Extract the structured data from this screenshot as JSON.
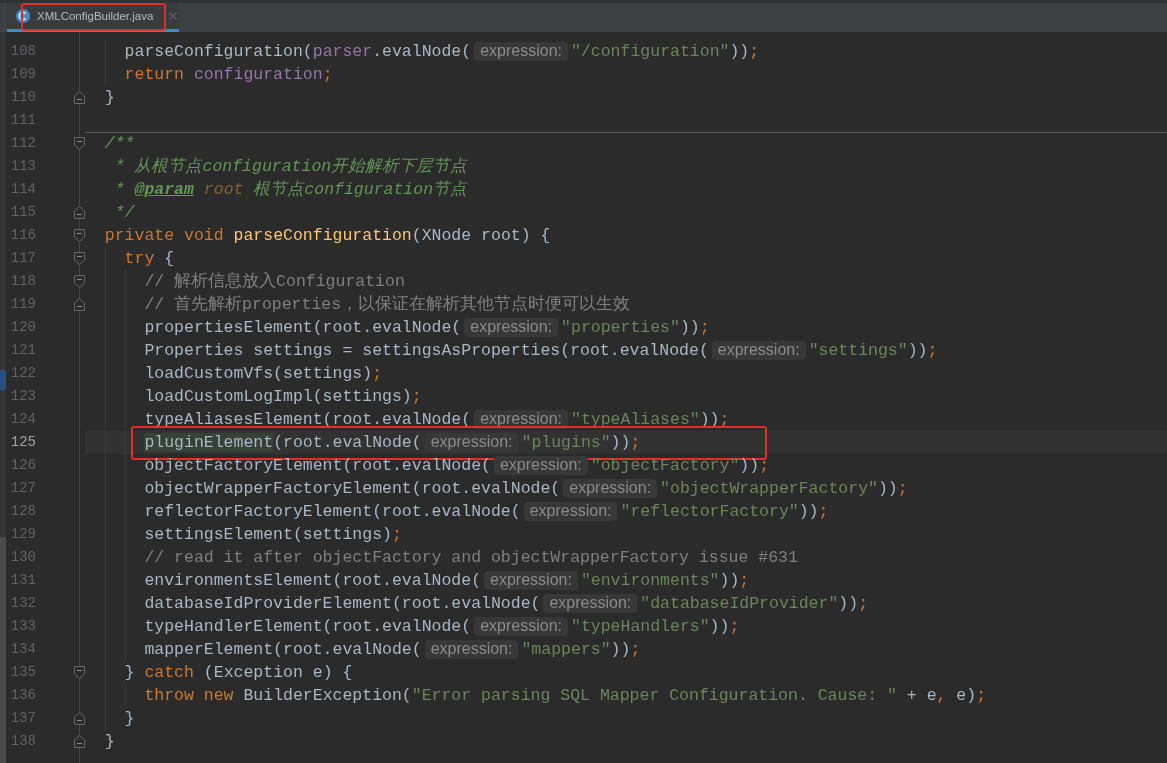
{
  "tabs": [
    {
      "label": "XMLConfigBuilder.java",
      "selected": true,
      "boxed": true
    }
  ],
  "editor": {
    "lines": [
      {
        "number": "108",
        "current": false,
        "boxed": false,
        "separator": false,
        "fold_start": false,
        "fold_end": false,
        "parts": [
          {
            "kind": "code",
            "tokens": [
              {
                "kind": "plain",
                "text": "    parseConfiguration("
              },
              {
                "kind": "field",
                "text": "parser"
              },
              {
                "kind": "plain",
                "text": ".evalNode("
              }
            ]
          },
          {
            "kind": "hint",
            "text": "expression:"
          },
          {
            "kind": "code",
            "tokens": [
              {
                "kind": "string",
                "text": "\"/configuration\""
              },
              {
                "kind": "plain",
                "text": "))"
              },
              {
                "kind": "separator",
                "text": ";"
              }
            ]
          }
        ]
      },
      {
        "number": "109",
        "current": false,
        "boxed": false,
        "separator": false,
        "fold_start": false,
        "fold_end": false,
        "parts": [
          {
            "kind": "code",
            "tokens": [
              {
                "kind": "keyword",
                "text": "    return "
              },
              {
                "kind": "field",
                "text": "configuration"
              },
              {
                "kind": "separator",
                "text": ";"
              }
            ]
          }
        ]
      },
      {
        "number": "110",
        "current": false,
        "boxed": false,
        "separator": false,
        "fold_start": false,
        "fold_end": true,
        "parts": [
          {
            "kind": "code",
            "tokens": [
              {
                "kind": "plain",
                "text": "  }"
              }
            ]
          }
        ]
      },
      {
        "number": "111",
        "current": false,
        "boxed": false,
        "separator": false,
        "fold_start": false,
        "fold_end": false
      },
      {
        "number": "112",
        "current": false,
        "boxed": false,
        "separator": true,
        "fold_start": true,
        "fold_end": false,
        "parts": [
          {
            "kind": "code",
            "tokens": [
              {
                "kind": "doc",
                "text": "  /**"
              }
            ]
          }
        ]
      },
      {
        "number": "113",
        "current": false,
        "boxed": false,
        "separator": false,
        "fold_start": false,
        "fold_end": false,
        "parts": [
          {
            "kind": "code",
            "tokens": [
              {
                "kind": "doc",
                "text": "   * 从根节点configuration开始解析下层节点"
              }
            ]
          }
        ]
      },
      {
        "number": "114",
        "current": false,
        "boxed": false,
        "separator": false,
        "fold_start": false,
        "fold_end": false,
        "parts": [
          {
            "kind": "code",
            "tokens": [
              {
                "kind": "doc",
                "text": "   * "
              },
              {
                "kind": "doc-tag",
                "text": "@param"
              },
              {
                "kind": "doc-value",
                "text": " root"
              },
              {
                "kind": "doc",
                "text": " 根节点configuration节点"
              }
            ]
          }
        ]
      },
      {
        "number": "115",
        "current": false,
        "boxed": false,
        "separator": false,
        "fold_start": false,
        "fold_end": true,
        "parts": [
          {
            "kind": "code",
            "tokens": [
              {
                "kind": "doc",
                "text": "   */"
              }
            ]
          }
        ]
      },
      {
        "number": "116",
        "current": false,
        "boxed": false,
        "separator": false,
        "fold_start": true,
        "fold_end": false,
        "parts": [
          {
            "kind": "code",
            "tokens": [
              {
                "kind": "keyword",
                "text": "  private void "
              },
              {
                "kind": "method",
                "text": "parseConfiguration"
              },
              {
                "kind": "plain",
                "text": "(XNode root) {"
              }
            ]
          }
        ]
      },
      {
        "number": "117",
        "current": false,
        "boxed": false,
        "separator": false,
        "fold_start": true,
        "fold_end": false,
        "parts": [
          {
            "kind": "code",
            "tokens": [
              {
                "kind": "keyword",
                "text": "    try"
              },
              {
                "kind": "plain",
                "text": " {"
              }
            ]
          }
        ]
      },
      {
        "number": "118",
        "current": false,
        "boxed": false,
        "separator": false,
        "fold_start": true,
        "fold_end": false,
        "parts": [
          {
            "kind": "code",
            "tokens": [
              {
                "kind": "comment",
                "text": "      // 解析信息放入Configuration"
              }
            ]
          }
        ]
      },
      {
        "number": "119",
        "current": false,
        "boxed": false,
        "separator": false,
        "fold_start": false,
        "fold_end": true,
        "parts": [
          {
            "kind": "code",
            "tokens": [
              {
                "kind": "comment",
                "text": "      // 首先解析properties，以保证在解析其他节点时便可以生效"
              }
            ]
          }
        ]
      },
      {
        "number": "120",
        "current": false,
        "boxed": false,
        "separator": false,
        "fold_start": false,
        "fold_end": false,
        "parts": [
          {
            "kind": "code",
            "tokens": [
              {
                "kind": "plain",
                "text": "      propertiesElement(root.evalNode("
              }
            ]
          },
          {
            "kind": "hint",
            "text": "expression:"
          },
          {
            "kind": "code",
            "tokens": [
              {
                "kind": "string",
                "text": "\"properties\""
              },
              {
                "kind": "plain",
                "text": "))"
              },
              {
                "kind": "separator",
                "text": ";"
              }
            ]
          }
        ]
      },
      {
        "number": "121",
        "current": false,
        "boxed": false,
        "separator": false,
        "fold_start": false,
        "fold_end": false,
        "parts": [
          {
            "kind": "code",
            "tokens": [
              {
                "kind": "plain",
                "text": "      Properties settings = settingsAsProperties(root.evalNode("
              }
            ]
          },
          {
            "kind": "hint",
            "text": "expression:"
          },
          {
            "kind": "code",
            "tokens": [
              {
                "kind": "string",
                "text": "\"settings\""
              },
              {
                "kind": "plain",
                "text": "))"
              },
              {
                "kind": "separator",
                "text": ";"
              }
            ]
          }
        ]
      },
      {
        "number": "122",
        "current": false,
        "boxed": false,
        "separator": false,
        "fold_start": false,
        "fold_end": false,
        "parts": [
          {
            "kind": "code",
            "tokens": [
              {
                "kind": "plain",
                "text": "      loadCustomVfs(settings)"
              },
              {
                "kind": "separator",
                "text": ";"
              }
            ]
          }
        ]
      },
      {
        "number": "123",
        "current": false,
        "boxed": false,
        "separator": false,
        "fold_start": false,
        "fold_end": false,
        "parts": [
          {
            "kind": "code",
            "tokens": [
              {
                "kind": "plain",
                "text": "      loadCustomLogImpl(settings)"
              },
              {
                "kind": "separator",
                "text": ";"
              }
            ]
          }
        ]
      },
      {
        "number": "124",
        "current": false,
        "boxed": false,
        "separator": false,
        "fold_start": false,
        "fold_end": false,
        "parts": [
          {
            "kind": "code",
            "tokens": [
              {
                "kind": "plain",
                "text": "      typeAliasesElement(root.evalNode("
              }
            ]
          },
          {
            "kind": "hint",
            "text": "expression:"
          },
          {
            "kind": "code",
            "tokens": [
              {
                "kind": "string",
                "text": "\"typeAliases\""
              },
              {
                "kind": "plain",
                "text": "))"
              },
              {
                "kind": "separator",
                "text": ";"
              }
            ]
          }
        ]
      },
      {
        "number": "125",
        "current": true,
        "boxed": true,
        "separator": false,
        "fold_start": false,
        "fold_end": false,
        "parts": [
          {
            "kind": "code",
            "tokens": [
              {
                "kind": "usage",
                "text": "      pluginElement"
              },
              {
                "kind": "plain",
                "text": "(root.evalNode("
              }
            ]
          },
          {
            "kind": "hint",
            "text": "expression:"
          },
          {
            "kind": "code",
            "tokens": [
              {
                "kind": "string",
                "text": "\"plugins\""
              },
              {
                "kind": "plain",
                "text": "))"
              },
              {
                "kind": "separator",
                "text": ";"
              }
            ]
          }
        ]
      },
      {
        "number": "126",
        "current": false,
        "boxed": false,
        "separator": false,
        "fold_start": false,
        "fold_end": false,
        "parts": [
          {
            "kind": "code",
            "tokens": [
              {
                "kind": "plain",
                "text": "      objectFactoryElement(root.evalNode("
              }
            ]
          },
          {
            "kind": "hint",
            "text": "expression:"
          },
          {
            "kind": "code",
            "tokens": [
              {
                "kind": "string",
                "text": "\"objectFactory\""
              },
              {
                "kind": "plain",
                "text": "))"
              },
              {
                "kind": "separator",
                "text": ";"
              }
            ]
          }
        ]
      },
      {
        "number": "127",
        "current": false,
        "boxed": false,
        "separator": false,
        "fold_start": false,
        "fold_end": false,
        "parts": [
          {
            "kind": "code",
            "tokens": [
              {
                "kind": "plain",
                "text": "      objectWrapperFactoryElement(root.evalNode("
              }
            ]
          },
          {
            "kind": "hint",
            "text": "expression:"
          },
          {
            "kind": "code",
            "tokens": [
              {
                "kind": "string",
                "text": "\"objectWrapperFactory\""
              },
              {
                "kind": "plain",
                "text": "))"
              },
              {
                "kind": "separator",
                "text": ";"
              }
            ]
          }
        ]
      },
      {
        "number": "128",
        "current": false,
        "boxed": false,
        "separator": false,
        "fold_start": false,
        "fold_end": false,
        "parts": [
          {
            "kind": "code",
            "tokens": [
              {
                "kind": "plain",
                "text": "      reflectorFactoryElement(root.evalNode("
              }
            ]
          },
          {
            "kind": "hint",
            "text": "expression:"
          },
          {
            "kind": "code",
            "tokens": [
              {
                "kind": "string",
                "text": "\"reflectorFactory\""
              },
              {
                "kind": "plain",
                "text": "))"
              },
              {
                "kind": "separator",
                "text": ";"
              }
            ]
          }
        ]
      },
      {
        "number": "129",
        "current": false,
        "boxed": false,
        "separator": false,
        "fold_start": false,
        "fold_end": false,
        "parts": [
          {
            "kind": "code",
            "tokens": [
              {
                "kind": "plain",
                "text": "      settingsElement(settings)"
              },
              {
                "kind": "separator",
                "text": ";"
              }
            ]
          }
        ]
      },
      {
        "number": "130",
        "current": false,
        "boxed": false,
        "separator": false,
        "fold_start": false,
        "fold_end": false,
        "parts": [
          {
            "kind": "code",
            "tokens": [
              {
                "kind": "comment",
                "text": "      // read it after objectFactory and objectWrapperFactory issue #631"
              }
            ]
          }
        ]
      },
      {
        "number": "131",
        "current": false,
        "boxed": false,
        "separator": false,
        "fold_start": false,
        "fold_end": false,
        "parts": [
          {
            "kind": "code",
            "tokens": [
              {
                "kind": "plain",
                "text": "      environmentsElement(root.evalNode("
              }
            ]
          },
          {
            "kind": "hint",
            "text": "expression:"
          },
          {
            "kind": "code",
            "tokens": [
              {
                "kind": "string",
                "text": "\"environments\""
              },
              {
                "kind": "plain",
                "text": "))"
              },
              {
                "kind": "separator",
                "text": ";"
              }
            ]
          }
        ]
      },
      {
        "number": "132",
        "current": false,
        "boxed": false,
        "separator": false,
        "fold_start": false,
        "fold_end": false,
        "parts": [
          {
            "kind": "code",
            "tokens": [
              {
                "kind": "plain",
                "text": "      databaseIdProviderElement(root.evalNode("
              }
            ]
          },
          {
            "kind": "hint",
            "text": "expression:"
          },
          {
            "kind": "code",
            "tokens": [
              {
                "kind": "string",
                "text": "\"databaseIdProvider\""
              },
              {
                "kind": "plain",
                "text": "))"
              },
              {
                "kind": "separator",
                "text": ";"
              }
            ]
          }
        ]
      },
      {
        "number": "133",
        "current": false,
        "boxed": false,
        "separator": false,
        "fold_start": false,
        "fold_end": false,
        "parts": [
          {
            "kind": "code",
            "tokens": [
              {
                "kind": "plain",
                "text": "      typeHandlerElement(root.evalNode("
              }
            ]
          },
          {
            "kind": "hint",
            "text": "expression:"
          },
          {
            "kind": "code",
            "tokens": [
              {
                "kind": "string",
                "text": "\"typeHandlers\""
              },
              {
                "kind": "plain",
                "text": "))"
              },
              {
                "kind": "separator",
                "text": ";"
              }
            ]
          }
        ]
      },
      {
        "number": "134",
        "current": false,
        "boxed": false,
        "separator": false,
        "fold_start": false,
        "fold_end": false,
        "parts": [
          {
            "kind": "code",
            "tokens": [
              {
                "kind": "plain",
                "text": "      mapperElement(root.evalNode("
              }
            ]
          },
          {
            "kind": "hint",
            "text": "expression:"
          },
          {
            "kind": "code",
            "tokens": [
              {
                "kind": "string",
                "text": "\"mappers\""
              },
              {
                "kind": "plain",
                "text": "))"
              },
              {
                "kind": "separator",
                "text": ";"
              }
            ]
          }
        ]
      },
      {
        "number": "135",
        "current": false,
        "boxed": false,
        "separator": false,
        "fold_start": true,
        "fold_end": false,
        "parts": [
          {
            "kind": "code",
            "tokens": [
              {
                "kind": "plain",
                "text": "    } "
              },
              {
                "kind": "keyword",
                "text": "catch"
              },
              {
                "kind": "plain",
                "text": " (Exception e) {"
              }
            ]
          }
        ]
      },
      {
        "number": "136",
        "current": false,
        "boxed": false,
        "separator": false,
        "fold_start": false,
        "fold_end": false,
        "parts": [
          {
            "kind": "code",
            "tokens": [
              {
                "kind": "keyword",
                "text": "      throw new "
              },
              {
                "kind": "plain",
                "text": "BuilderException("
              },
              {
                "kind": "string",
                "text": "\"Error parsing SQL Mapper Configuration. Cause: \""
              },
              {
                "kind": "plain",
                "text": " + e"
              },
              {
                "kind": "separator",
                "text": ","
              },
              {
                "kind": "plain",
                "text": " e)"
              },
              {
                "kind": "separator",
                "text": ";"
              }
            ]
          }
        ]
      },
      {
        "number": "137",
        "current": false,
        "boxed": false,
        "separator": false,
        "fold_start": false,
        "fold_end": true,
        "parts": [
          {
            "kind": "code",
            "tokens": [
              {
                "kind": "plain",
                "text": "    }"
              }
            ]
          }
        ]
      },
      {
        "number": "138",
        "current": false,
        "boxed": false,
        "separator": false,
        "fold_start": false,
        "fold_end": true,
        "parts": [
          {
            "kind": "code",
            "tokens": [
              {
                "kind": "plain",
                "text": "  }"
              }
            ]
          }
        ]
      }
    ]
  }
}
